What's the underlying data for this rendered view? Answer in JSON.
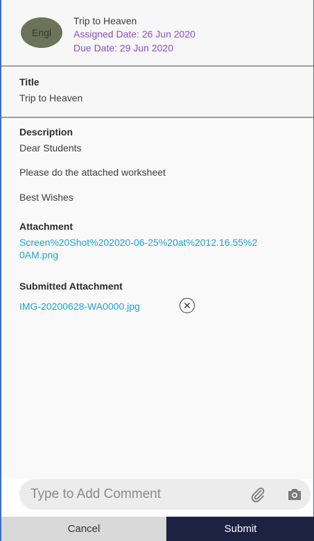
{
  "header": {
    "avatar_text": "Engl",
    "title": "Trip to Heaven",
    "assigned": "Assigned Date: 26 Jun 2020",
    "due": "Due Date: 29 Jun 2020"
  },
  "title_section": {
    "label": "Title",
    "value": "Trip to Heaven"
  },
  "description": {
    "label": "Description",
    "lines": [
      "Dear Students",
      "Please do the attached worksheet",
      "Best Wishes"
    ]
  },
  "attachment": {
    "label": "Attachment",
    "link_line1": "Screen%20Shot%202020-06-25%20at%2012.16.55%2",
    "link_line2": "0AM.png"
  },
  "submitted_attachment": {
    "label": "Submitted Attachment",
    "file": "IMG-20200628-WA0000.jpg"
  },
  "comment": {
    "placeholder": "Type to Add Comment"
  },
  "footer": {
    "cancel_label": "Cancel",
    "submit_label": "Submit"
  },
  "colors": {
    "accent_purple": "#8a4ec2",
    "link_blue": "#1e9fd3",
    "submit_bg": "#1d2142"
  },
  "icons": [
    "attach-icon",
    "camera-icon",
    "remove-icon"
  ]
}
